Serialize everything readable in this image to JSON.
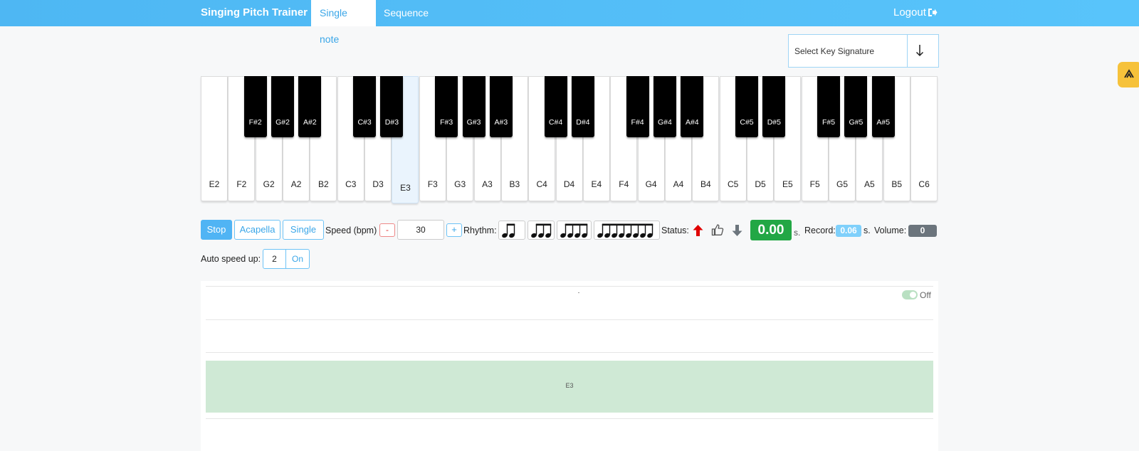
{
  "navbar": {
    "brand": "Singing Pitch Trainer",
    "tabs": [
      {
        "label": "Single note",
        "active": true
      },
      {
        "label": "Sequence",
        "active": false
      }
    ],
    "logout_label": "Logout",
    "logout_icon": "sign-out-icon"
  },
  "key_signature": {
    "placeholder": "Select Key Signature",
    "icon": "arrow-down-icon"
  },
  "piano": {
    "white_keys": [
      "E2",
      "F2",
      "G2",
      "A2",
      "B2",
      "C3",
      "D3",
      "E3",
      "F3",
      "G3",
      "A3",
      "B3",
      "C4",
      "D4",
      "E4",
      "F4",
      "G4",
      "A4",
      "B4",
      "C5",
      "D5",
      "E5",
      "F5",
      "G5",
      "A5",
      "B5",
      "C6"
    ],
    "black_keys": [
      {
        "label": "F#2",
        "after": "F2"
      },
      {
        "label": "G#2",
        "after": "G2"
      },
      {
        "label": "A#2",
        "after": "A2"
      },
      {
        "label": "C#3",
        "after": "C3"
      },
      {
        "label": "D#3",
        "after": "D3"
      },
      {
        "label": "F#3",
        "after": "F3"
      },
      {
        "label": "G#3",
        "after": "G3"
      },
      {
        "label": "A#3",
        "after": "A3"
      },
      {
        "label": "C#4",
        "after": "C4"
      },
      {
        "label": "D#4",
        "after": "D4"
      },
      {
        "label": "F#4",
        "after": "F4"
      },
      {
        "label": "G#4",
        "after": "G4"
      },
      {
        "label": "A#4",
        "after": "A4"
      },
      {
        "label": "C#5",
        "after": "C5"
      },
      {
        "label": "D#5",
        "after": "D5"
      },
      {
        "label": "F#5",
        "after": "F5"
      },
      {
        "label": "G#5",
        "after": "G5"
      },
      {
        "label": "A#5",
        "after": "A5"
      }
    ],
    "active_key": "E3"
  },
  "controls": {
    "stop_label": "Stop",
    "acapella_label": "Acapella",
    "single_label": "Single",
    "speed_label": "Speed (bpm)",
    "speed_minus": "-",
    "speed_value": "30",
    "speed_plus": "+",
    "rhythm_label": "Rhythm:",
    "rhythm_options": [
      {
        "name": "two-eighth-notes",
        "notes": 2
      },
      {
        "name": "three-eighth-notes",
        "notes": 3
      },
      {
        "name": "four-eighth-notes",
        "notes": 4
      },
      {
        "name": "eight-eighth-notes",
        "notes": 8
      }
    ],
    "status_label": "Status:",
    "status_icons": [
      "arrow-up-icon",
      "thumbs-up-icon",
      "arrow-down-icon"
    ],
    "timer_value": "0.00",
    "timer_unit": "s.",
    "record_label": "Record:",
    "record_value": "0.06",
    "record_unit": "s.",
    "volume_label": "Volume:",
    "volume_value": "0",
    "auto_speed_label": "Auto speed up:",
    "auto_speed_value": "2",
    "auto_speed_toggle": "On"
  },
  "graph": {
    "band_label": "E3",
    "toggle_label": "Off",
    "toggle_on": false
  },
  "colors": {
    "navbar": "#58c4fb",
    "primary": "#50b4f4",
    "success": "#22a745",
    "danger": "#e00000",
    "band": "#cfe9d5"
  }
}
